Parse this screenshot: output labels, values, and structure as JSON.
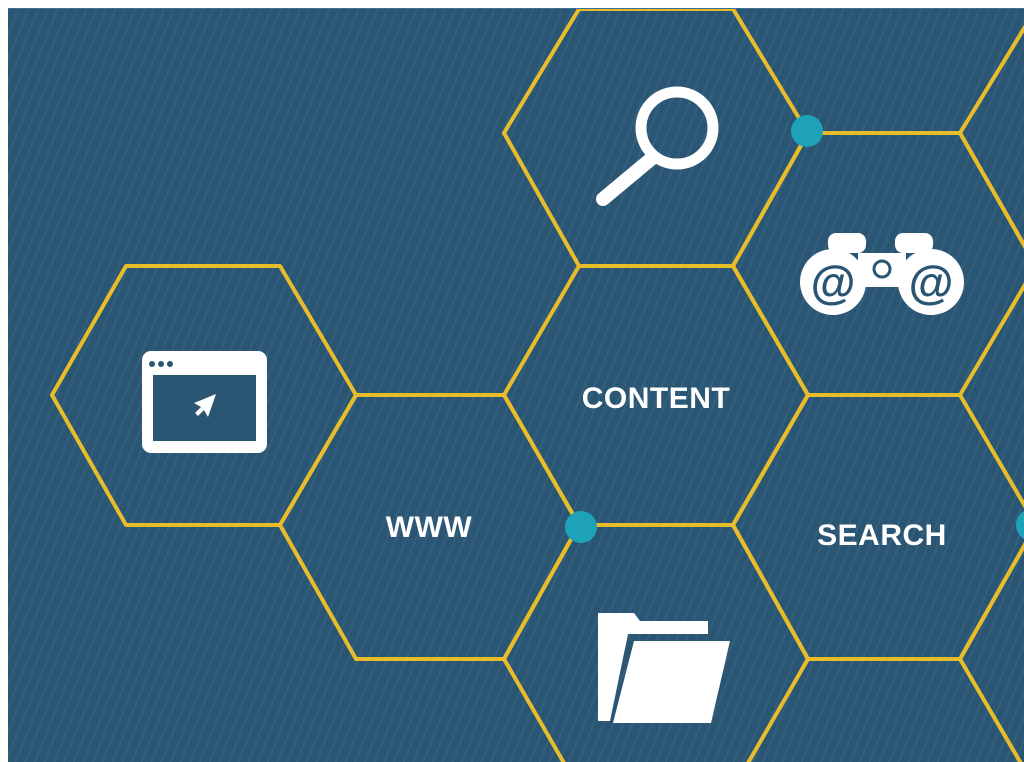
{
  "labels": {
    "content": "CONTENT",
    "www": "WWW",
    "search": "SEARCH"
  },
  "icons": [
    "magnifying-glass-icon",
    "binoculars-email-icon",
    "browser-window-cursor-icon",
    "folder-icon"
  ],
  "binoculars_text": {
    "left": "@",
    "right": "@"
  },
  "colors": {
    "background": "#2a5573",
    "stripe": "#335f7e",
    "hex_stroke": "#e9bd2a",
    "node_dot": "#1da2b8",
    "icon_fill": "#ffffff",
    "text": "#ffffff"
  }
}
